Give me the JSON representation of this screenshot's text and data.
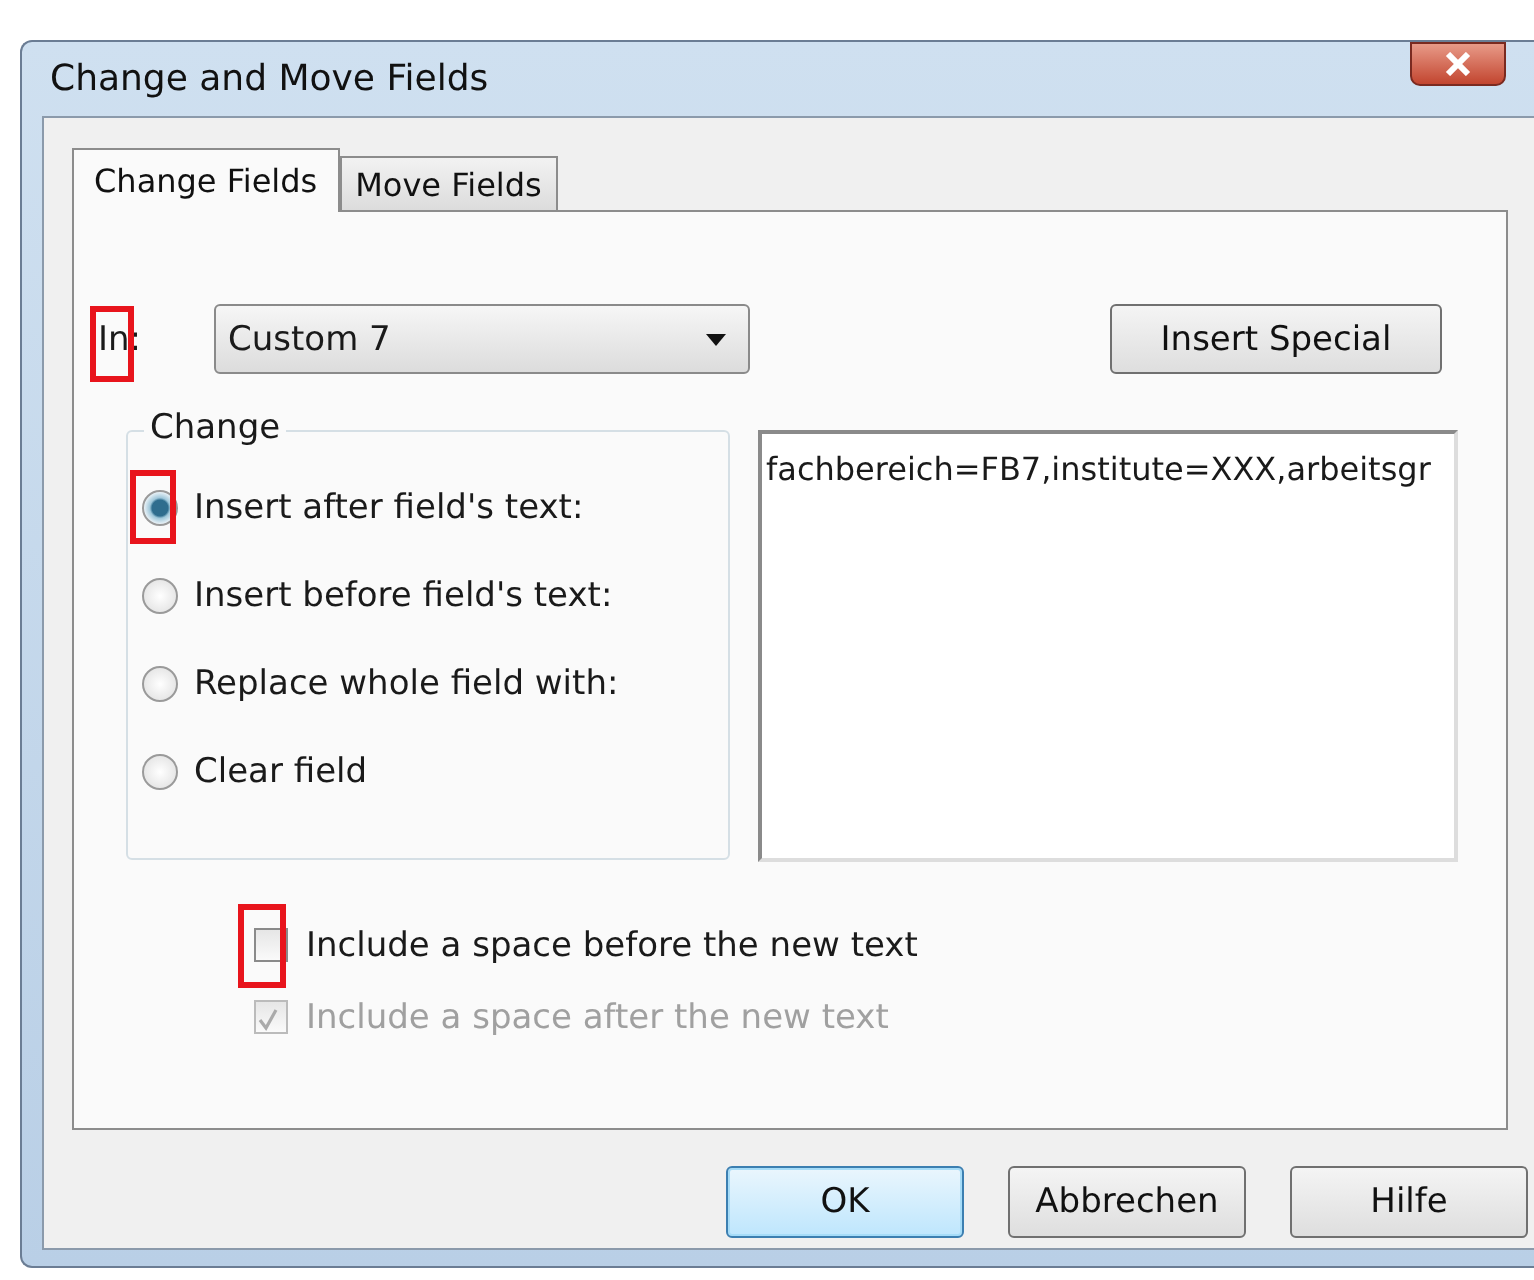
{
  "window": {
    "title": "Change and Move Fields"
  },
  "tabs": [
    {
      "label": "Change Fields",
      "selected": true
    },
    {
      "label": "Move Fields",
      "selected": false
    }
  ],
  "in_field": {
    "label": "In:",
    "value": "Custom 7",
    "highlighted": true
  },
  "insert_special_button": "Insert Special",
  "change_group": {
    "title": "Change",
    "options": [
      {
        "label": "Insert after field's text:",
        "selected": true,
        "highlighted": true
      },
      {
        "label": "Insert before field's text:",
        "selected": false,
        "highlighted": false
      },
      {
        "label": "Replace whole field with:",
        "selected": false,
        "highlighted": false
      },
      {
        "label": "Clear field",
        "selected": false,
        "highlighted": false
      }
    ]
  },
  "text_field": {
    "value": "fachbereich=FB7,institute=XXX,arbeitsgr"
  },
  "checkboxes": [
    {
      "label": "Include a space before the new text",
      "checked": false,
      "disabled": false,
      "highlighted": true
    },
    {
      "label": "Include a space after the new text",
      "checked": true,
      "disabled": true,
      "highlighted": false
    }
  ],
  "buttons": [
    {
      "label": "OK",
      "kind": "default"
    },
    {
      "label": "Abbrechen",
      "kind": "normal"
    },
    {
      "label": "Hilfe",
      "kind": "normal"
    }
  ]
}
